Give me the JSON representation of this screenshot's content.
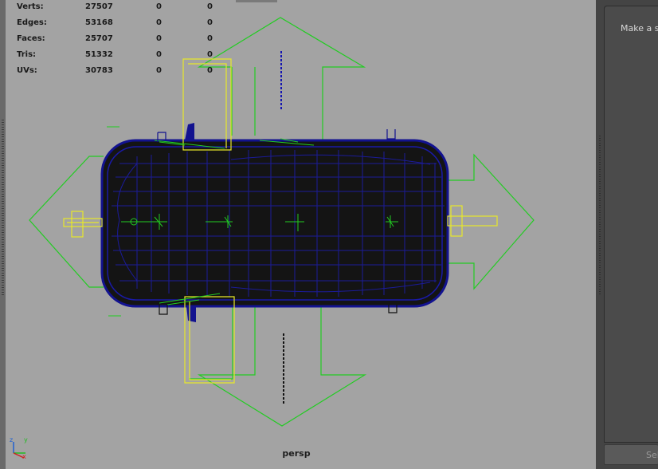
{
  "hud": {
    "rows": [
      {
        "label": "Verts:",
        "v1": "27507",
        "v2": "0",
        "v3": "0"
      },
      {
        "label": "Edges:",
        "v1": "53168",
        "v2": "0",
        "v3": "0"
      },
      {
        "label": "Faces:",
        "v1": "25707",
        "v2": "0",
        "v3": "0"
      },
      {
        "label": "Tris:",
        "v1": "51332",
        "v2": "0",
        "v3": "0"
      },
      {
        "label": "UVs:",
        "v1": "30783",
        "v2": "0",
        "v3": "0"
      }
    ]
  },
  "viewport": {
    "camera_label": "persp",
    "axis_labels": {
      "z": "z",
      "y": "y",
      "x": "x"
    },
    "colors": {
      "background": "#a3a3a3",
      "manipulator": "#22cc22",
      "selection": "#ffff33",
      "mesh_wire": "#12128f",
      "mesh_fill": "#141414"
    }
  },
  "side_panel": {
    "hint_text": "Make a se",
    "button_label": "Sel"
  }
}
